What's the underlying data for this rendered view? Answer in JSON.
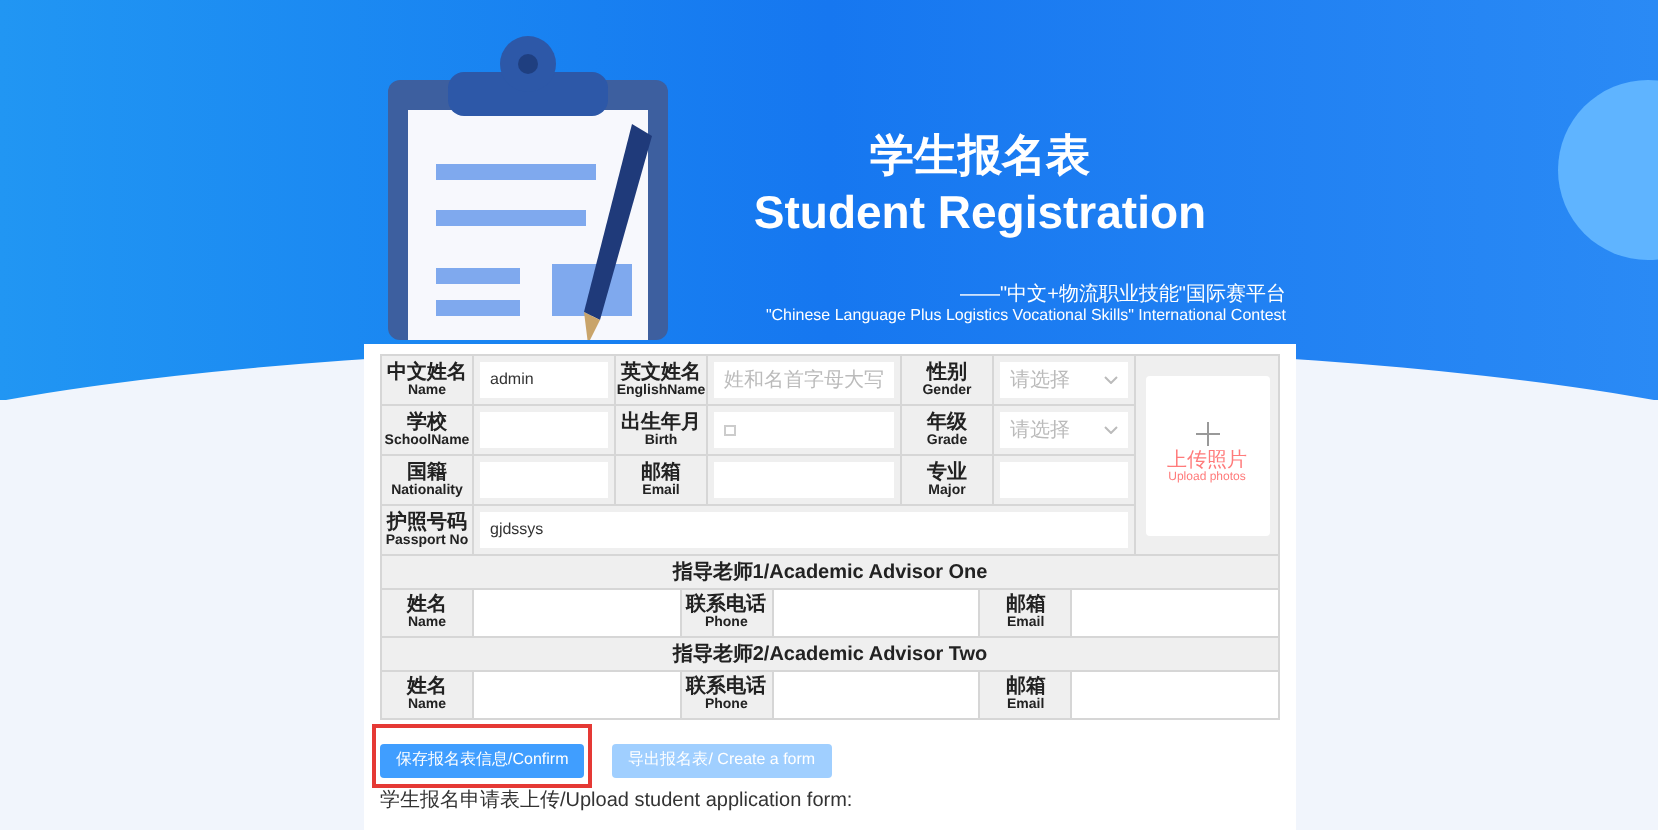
{
  "header": {
    "title_zh": "学生报名表",
    "title_en": "Student Registration",
    "subtitle_zh": "——\"中文+物流职业技能\"国际赛平台",
    "subtitle_en": "\"Chinese Language Plus Logistics Vocational Skills\" International Contest"
  },
  "fields": [
    {
      "label_zh": "中文姓名",
      "label_en": "Name",
      "kind": "text",
      "value": "admin"
    },
    {
      "label_zh": "英文姓名",
      "label_en": "EnglishName",
      "kind": "text",
      "placeholder": "姓和名首字母大写"
    },
    {
      "label_zh": "性别",
      "label_en": "Gender",
      "kind": "select",
      "placeholder": "请选择"
    },
    {
      "label_zh": "学校",
      "label_en": "SchoolName",
      "kind": "text"
    },
    {
      "label_zh": "出生年月",
      "label_en": "Birth",
      "kind": "date"
    },
    {
      "label_zh": "年级",
      "label_en": "Grade",
      "kind": "select",
      "placeholder": "请选择"
    },
    {
      "label_zh": "国籍",
      "label_en": "Nationality",
      "kind": "text"
    },
    {
      "label_zh": "邮箱",
      "label_en": "Email",
      "kind": "text"
    },
    {
      "label_zh": "专业",
      "label_en": "Major",
      "kind": "text"
    },
    {
      "label_zh": "护照号码",
      "label_en": "Passport No",
      "kind": "text",
      "value": "gjdssys"
    }
  ],
  "photo_upload": {
    "label_zh": "上传照片",
    "label_en": "Upload photos"
  },
  "advisors": [
    {
      "heading": "指导老师1/Academic Advisor One",
      "fields": [
        {
          "label_zh": "姓名",
          "label_en": "Name"
        },
        {
          "label_zh": "联系电话",
          "label_en": "Phone"
        },
        {
          "label_zh": "邮箱",
          "label_en": "Email"
        }
      ]
    },
    {
      "heading": "指导老师2/Academic Advisor Two",
      "fields": [
        {
          "label_zh": "姓名",
          "label_en": "Name"
        },
        {
          "label_zh": "联系电话",
          "label_en": "Phone"
        },
        {
          "label_zh": "邮箱",
          "label_en": "Email"
        }
      ]
    }
  ],
  "buttons": [
    {
      "label": "保存报名表信息/Confirm",
      "highlighted": true,
      "disabled": false
    },
    {
      "label": "导出报名表/ Create a form",
      "highlighted": false,
      "disabled": true
    }
  ],
  "upload_note": "学生报名申请表上传/Upload student application form:"
}
